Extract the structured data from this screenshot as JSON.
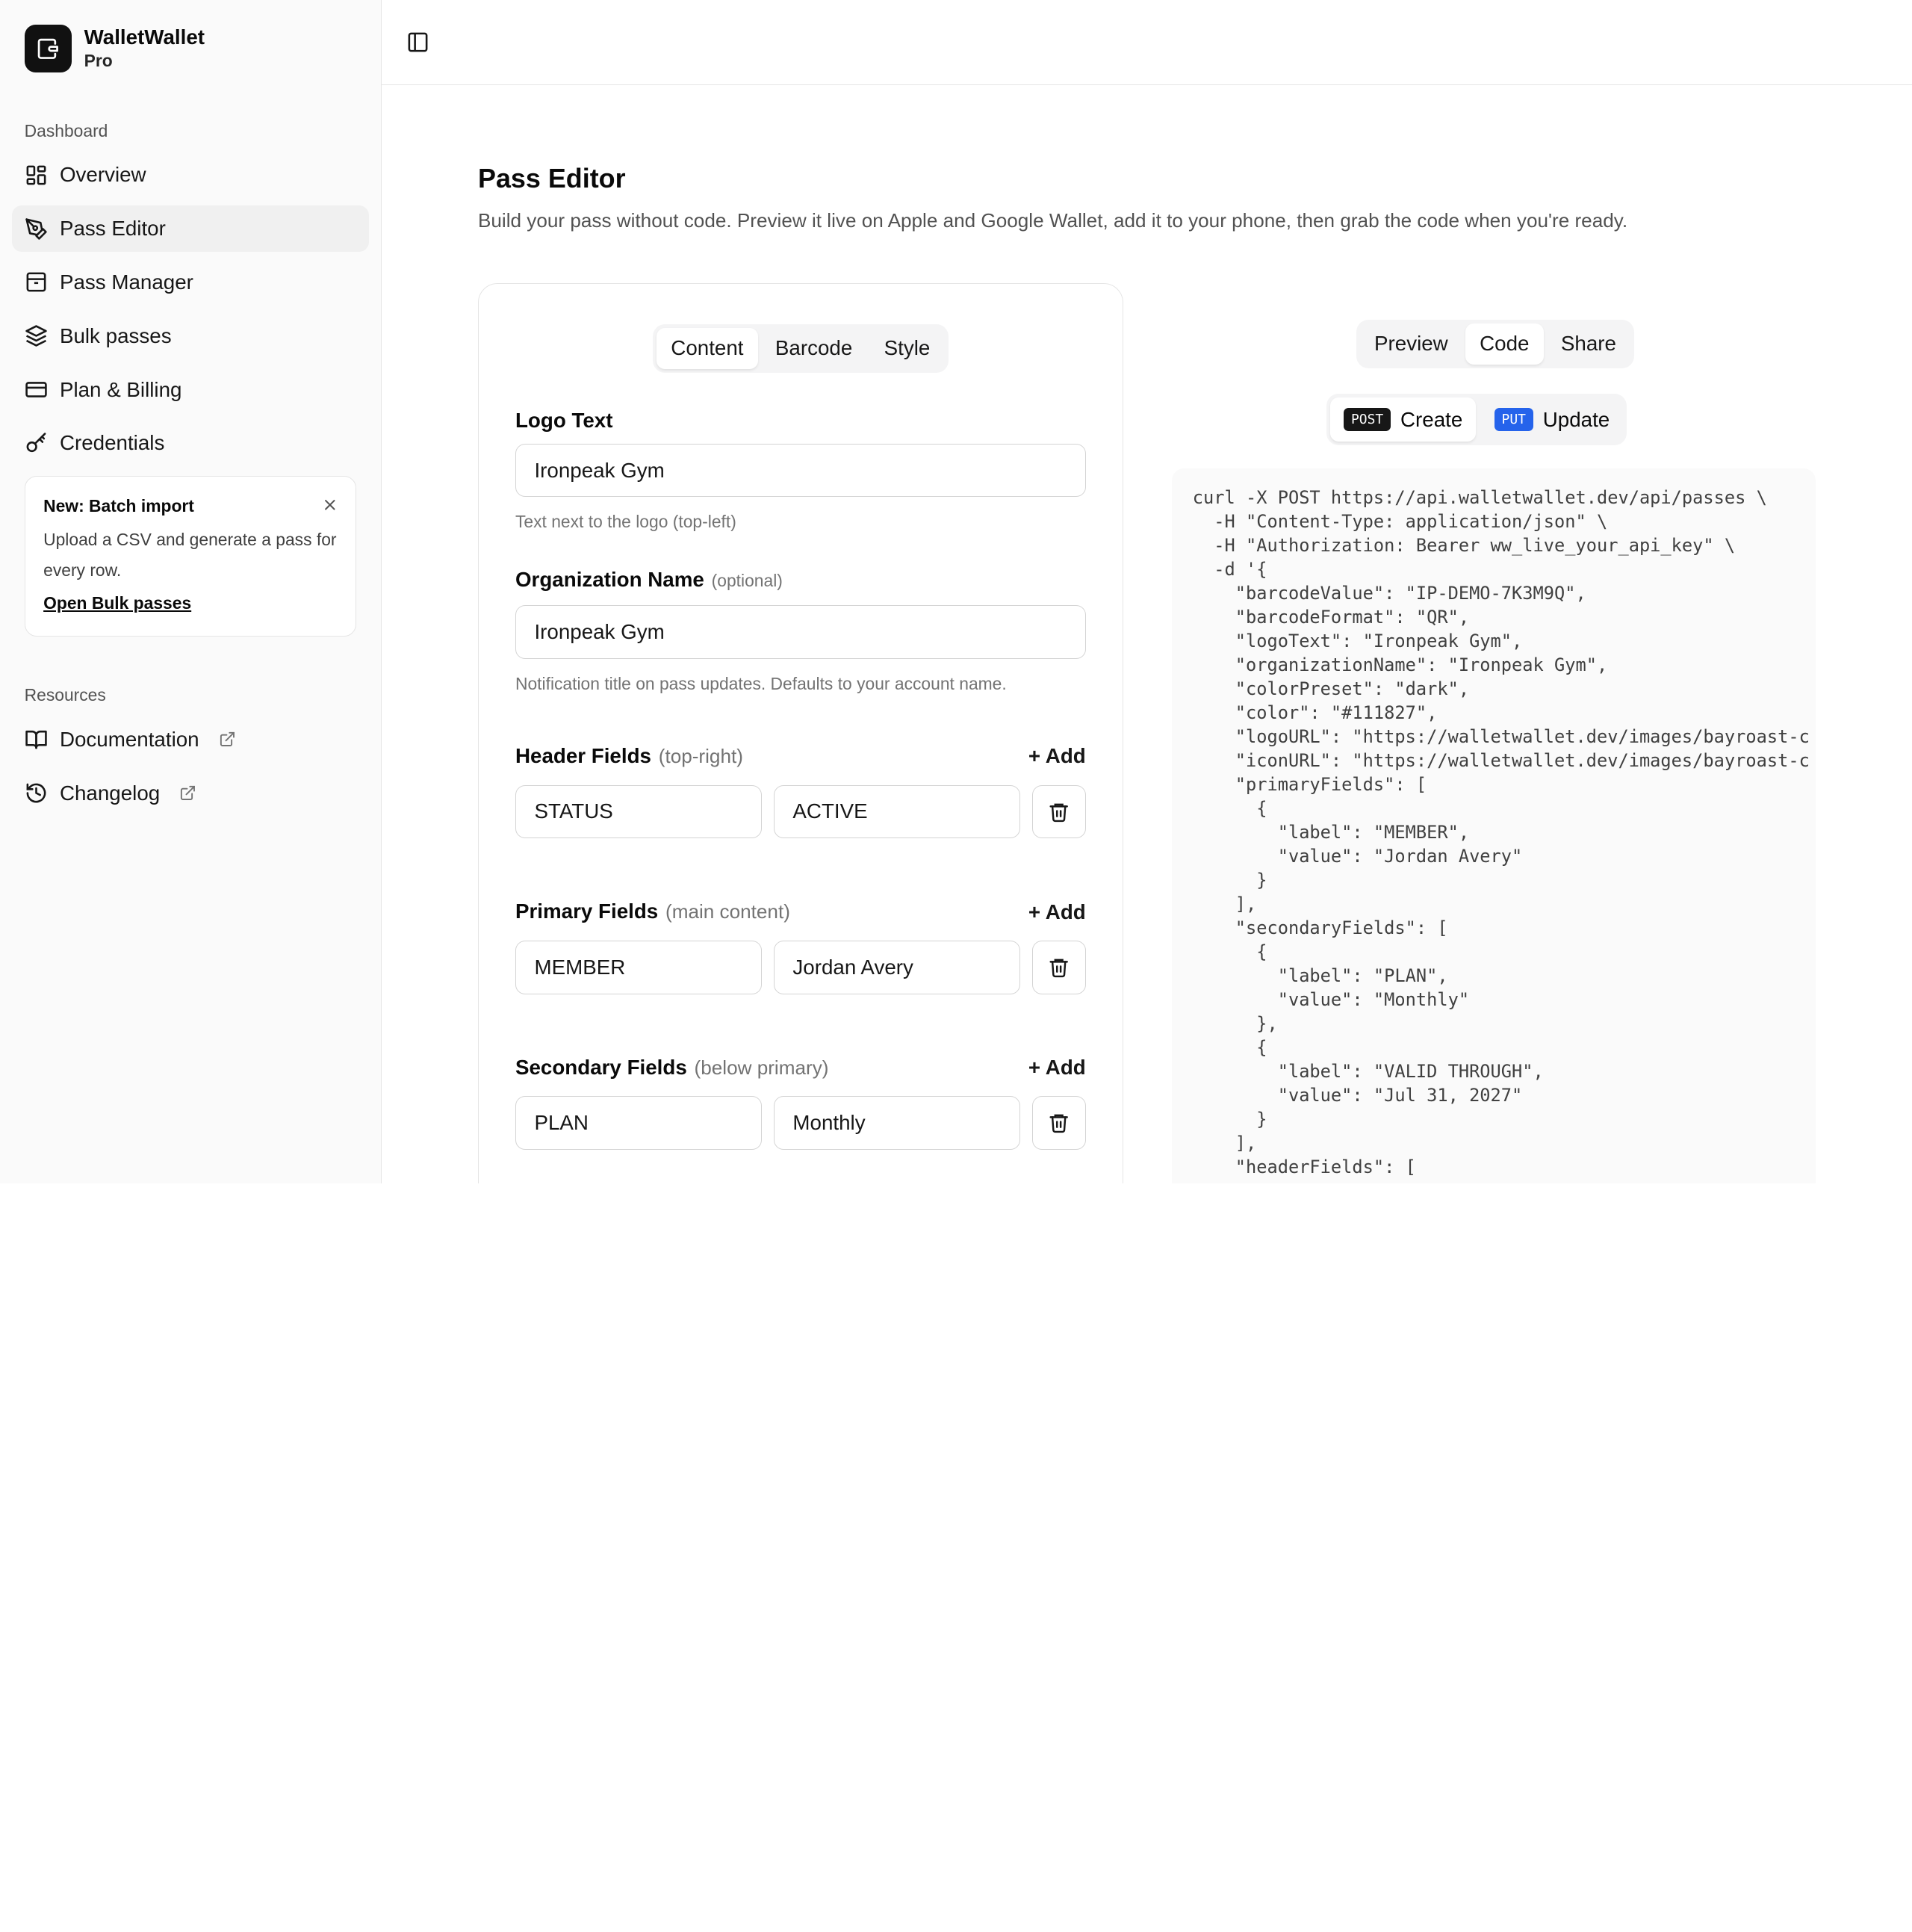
{
  "brand": {
    "name": "WalletWallet",
    "plan": "Pro"
  },
  "sidebar": {
    "dashboard_label": "Dashboard",
    "items": [
      {
        "label": "Overview",
        "icon": "grid-icon"
      },
      {
        "label": "Pass Editor",
        "icon": "pen-icon",
        "active": true
      },
      {
        "label": "Pass Manager",
        "icon": "archive-icon"
      },
      {
        "label": "Bulk passes",
        "icon": "layers-icon"
      },
      {
        "label": "Plan & Billing",
        "icon": "credit-card-icon"
      },
      {
        "label": "Credentials",
        "icon": "key-icon"
      }
    ],
    "promo": {
      "title": "New: Batch import",
      "body": "Upload a CSV and generate a pass for every row.",
      "link": "Open Bulk passes"
    },
    "resources_label": "Resources",
    "resources": [
      {
        "label": "Documentation",
        "icon": "book-icon"
      },
      {
        "label": "Changelog",
        "icon": "history-icon"
      }
    ]
  },
  "page": {
    "title": "Pass Editor",
    "subtitle": "Build your pass without code. Preview it live on Apple and Google Wallet, add it to your phone, then grab the code when you're ready."
  },
  "editor": {
    "tabs": [
      "Content",
      "Barcode",
      "Style"
    ],
    "active_tab": "Content",
    "logo_text": {
      "label": "Logo Text",
      "value": "Ironpeak Gym",
      "help": "Text next to the logo (top-left)"
    },
    "org_name": {
      "label": "Organization Name",
      "optional": "(optional)",
      "value": "Ironpeak Gym",
      "help": "Notification title on pass updates. Defaults to your account name."
    },
    "add_label": "+ Add",
    "header_fields": {
      "label": "Header Fields",
      "hint": "(top-right)",
      "key": "STATUS",
      "value": "ACTIVE"
    },
    "primary_fields": {
      "label": "Primary Fields",
      "hint": "(main content)",
      "key": "MEMBER",
      "value": "Jordan Avery"
    },
    "secondary_fields": {
      "label": "Secondary Fields",
      "hint": "(below primary)",
      "key": "PLAN",
      "value": "Monthly"
    }
  },
  "right": {
    "tabs": [
      "Preview",
      "Code",
      "Share"
    ],
    "active_tab": "Code",
    "methods": [
      {
        "badge": "POST",
        "label": "Create"
      },
      {
        "badge": "PUT",
        "label": "Update"
      }
    ],
    "code_lines": [
      "curl -X POST https://api.walletwallet.dev/api/passes \\",
      "  -H \"Content-Type: application/json\" \\",
      "  -H \"Authorization: Bearer ww_live_your_api_key\" \\",
      "  -d '{",
      "    \"barcodeValue\": \"IP-DEMO-7K3M9Q\",",
      "    \"barcodeFormat\": \"QR\",",
      "    \"logoText\": \"Ironpeak Gym\",",
      "    \"organizationName\": \"Ironpeak Gym\",",
      "    \"colorPreset\": \"dark\",",
      "    \"color\": \"#111827\",",
      "    \"logoURL\": \"https://walletwallet.dev/images/bayroast-c",
      "    \"iconURL\": \"https://walletwallet.dev/images/bayroast-c",
      "    \"primaryFields\": [",
      "      {",
      "        \"label\": \"MEMBER\",",
      "        \"value\": \"Jordan Avery\"",
      "      }",
      "    ],",
      "    \"secondaryFields\": [",
      "      {",
      "        \"label\": \"PLAN\",",
      "        \"value\": \"Monthly\"",
      "      },",
      "      {",
      "        \"label\": \"VALID THROUGH\",",
      "        \"value\": \"Jul 31, 2027\"",
      "      }",
      "    ],",
      "    \"headerFields\": ["
    ]
  }
}
